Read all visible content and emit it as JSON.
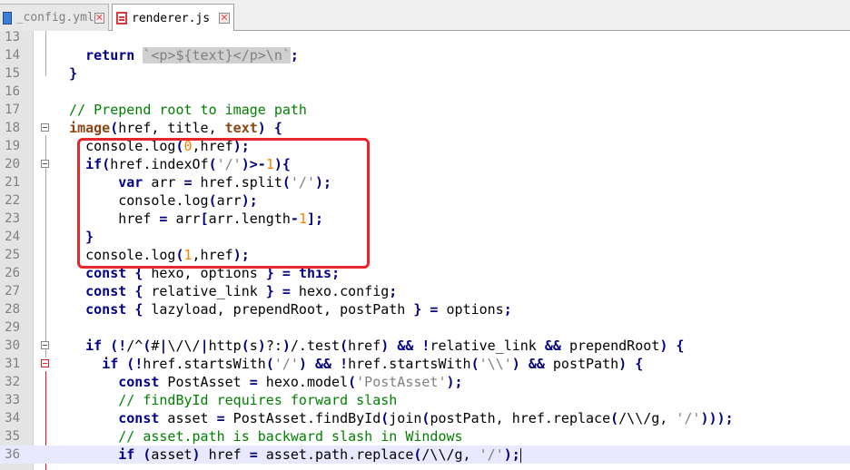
{
  "tabs": [
    {
      "name": "_config.yml",
      "icon": "yaml-file-icon",
      "active": false
    },
    {
      "name": "renderer.js",
      "icon": "js-file-icon",
      "active": true
    }
  ],
  "close_glyph": "✕",
  "lines": [
    {
      "n": "13",
      "text": ""
    },
    {
      "n": "14",
      "text": "    return `<p>${text}</p>\\n`;"
    },
    {
      "n": "15",
      "text": "  }"
    },
    {
      "n": "16",
      "text": ""
    },
    {
      "n": "17",
      "text": "  // Prepend root to image path"
    },
    {
      "n": "18",
      "text": "  image(href, title, text) {"
    },
    {
      "n": "19",
      "text": "    console.log(0,href);"
    },
    {
      "n": "20",
      "text": "    if(href.indexOf('/')>-1){"
    },
    {
      "n": "21",
      "text": "        var arr = href.split('/');"
    },
    {
      "n": "22",
      "text": "        console.log(arr);"
    },
    {
      "n": "23",
      "text": "        href = arr[arr.length-1];"
    },
    {
      "n": "24",
      "text": "    }"
    },
    {
      "n": "25",
      "text": "    console.log(1,href);"
    },
    {
      "n": "26",
      "text": "    const { hexo, options } = this;"
    },
    {
      "n": "27",
      "text": "    const { relative_link } = hexo.config;"
    },
    {
      "n": "28",
      "text": "    const { lazyload, prependRoot, postPath } = options;"
    },
    {
      "n": "29",
      "text": ""
    },
    {
      "n": "30",
      "text": "    if (!/^(#|\\/\\/|http(s)?:)/.test(href) && !relative_link && prependRoot) {"
    },
    {
      "n": "31",
      "text": "      if (!href.startsWith('/') && !href.startsWith('\\\\') && postPath) {"
    },
    {
      "n": "32",
      "text": "        const PostAsset = hexo.model('PostAsset');"
    },
    {
      "n": "33",
      "text": "        // findById requires forward slash"
    },
    {
      "n": "34",
      "text": "        const asset = PostAsset.findById(join(postPath, href.replace(/\\\\/g, '/')));"
    },
    {
      "n": "35",
      "text": "        // asset.path is backward slash in Windows"
    },
    {
      "n": "36",
      "text": "        if (asset) href = asset.path.replace(/\\\\/g, '/');"
    }
  ]
}
